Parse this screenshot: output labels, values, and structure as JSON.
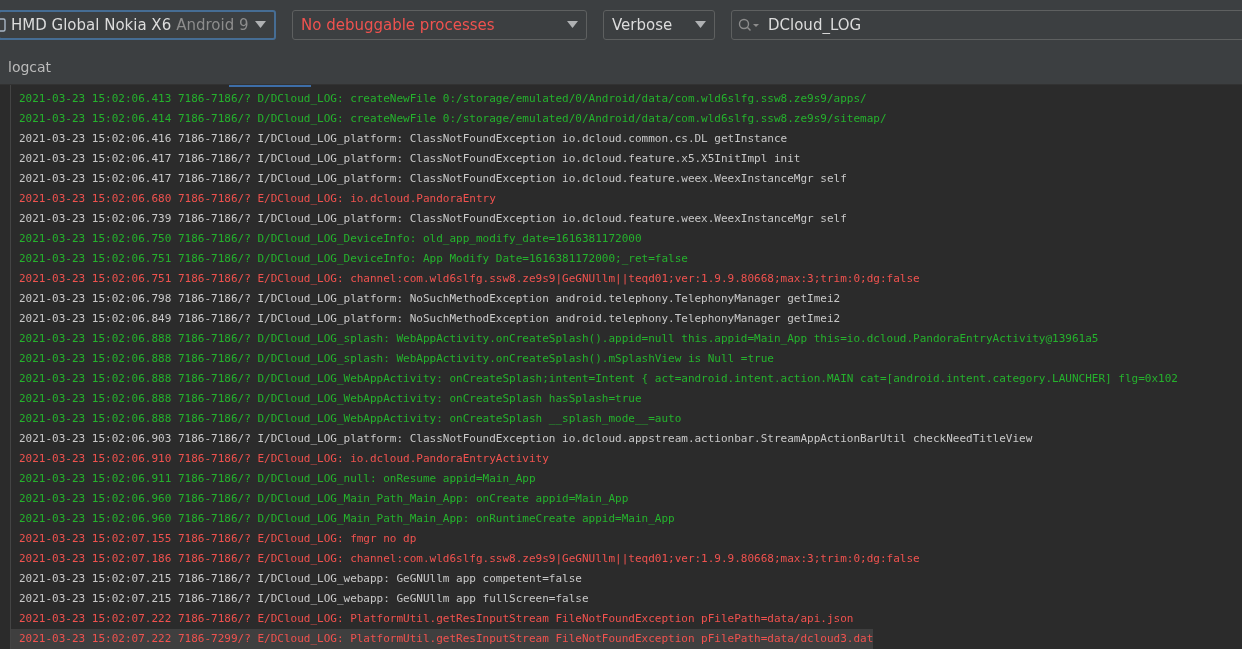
{
  "toolbar": {
    "device": {
      "name": "HMD Global Nokia X6",
      "version": "Android 9",
      "focused": true
    },
    "process": {
      "value": "No debuggable processes",
      "error": true
    },
    "log_level": {
      "value": "Verbose"
    },
    "search": {
      "value": "DCloud_LOG"
    }
  },
  "panel_title": "logcat",
  "rows": [
    {
      "kind": "debug",
      "selected": false,
      "text": "2021-03-23 15:02:06.413 7186-7186/? D/DCloud_LOG: createNewFile 0:/storage/emulated/0/Android/data/com.wld6slfg.ssw8.ze9s9/apps/"
    },
    {
      "kind": "debug",
      "selected": false,
      "text": "2021-03-23 15:02:06.414 7186-7186/? D/DCloud_LOG: createNewFile 0:/storage/emulated/0/Android/data/com.wld6slfg.ssw8.ze9s9/sitemap/"
    },
    {
      "kind": "info",
      "selected": false,
      "text": "2021-03-23 15:02:06.416 7186-7186/? I/DCloud_LOG_platform: ClassNotFoundException io.dcloud.common.cs.DL getInstance"
    },
    {
      "kind": "info",
      "selected": false,
      "text": "2021-03-23 15:02:06.417 7186-7186/? I/DCloud_LOG_platform: ClassNotFoundException io.dcloud.feature.x5.X5InitImpl init"
    },
    {
      "kind": "info",
      "selected": false,
      "text": "2021-03-23 15:02:06.417 7186-7186/? I/DCloud_LOG_platform: ClassNotFoundException io.dcloud.feature.weex.WeexInstanceMgr self"
    },
    {
      "kind": "error",
      "selected": false,
      "text": "2021-03-23 15:02:06.680 7186-7186/? E/DCloud_LOG: io.dcloud.PandoraEntry"
    },
    {
      "kind": "info",
      "selected": false,
      "text": "2021-03-23 15:02:06.739 7186-7186/? I/DCloud_LOG_platform: ClassNotFoundException io.dcloud.feature.weex.WeexInstanceMgr self"
    },
    {
      "kind": "debug",
      "selected": false,
      "text": "2021-03-23 15:02:06.750 7186-7186/? D/DCloud_LOG_DeviceInfo: old_app_modify_date=1616381172000"
    },
    {
      "kind": "debug",
      "selected": false,
      "text": "2021-03-23 15:02:06.751 7186-7186/? D/DCloud_LOG_DeviceInfo: App Modify Date=1616381172000;_ret=false"
    },
    {
      "kind": "error",
      "selected": false,
      "text": "2021-03-23 15:02:06.751 7186-7186/? E/DCloud_LOG: channel:com.wld6slfg.ssw8.ze9s9|GeGNUllm||teqd01;ver:1.9.9.80668;max:3;trim:0;dg:false"
    },
    {
      "kind": "info",
      "selected": false,
      "text": "2021-03-23 15:02:06.798 7186-7186/? I/DCloud_LOG_platform: NoSuchMethodException android.telephony.TelephonyManager getImei2"
    },
    {
      "kind": "info",
      "selected": false,
      "text": "2021-03-23 15:02:06.849 7186-7186/? I/DCloud_LOG_platform: NoSuchMethodException android.telephony.TelephonyManager getImei2"
    },
    {
      "kind": "debug",
      "selected": false,
      "text": "2021-03-23 15:02:06.888 7186-7186/? D/DCloud_LOG_splash: WebAppActivity.onCreateSplash().appid=null this.appid=Main_App this=io.dcloud.PandoraEntryActivity@13961a5"
    },
    {
      "kind": "debug",
      "selected": false,
      "text": "2021-03-23 15:02:06.888 7186-7186/? D/DCloud_LOG_splash: WebAppActivity.onCreateSplash().mSplashView is Null =true"
    },
    {
      "kind": "debug",
      "selected": false,
      "text": "2021-03-23 15:02:06.888 7186-7186/? D/DCloud_LOG_WebAppActivity: onCreateSplash;intent=Intent { act=android.intent.action.MAIN cat=[android.intent.category.LAUNCHER] flg=0x102"
    },
    {
      "kind": "debug",
      "selected": false,
      "text": "2021-03-23 15:02:06.888 7186-7186/? D/DCloud_LOG_WebAppActivity: onCreateSplash hasSplash=true"
    },
    {
      "kind": "debug",
      "selected": false,
      "text": "2021-03-23 15:02:06.888 7186-7186/? D/DCloud_LOG_WebAppActivity: onCreateSplash __splash_mode__=auto"
    },
    {
      "kind": "info",
      "selected": false,
      "text": "2021-03-23 15:02:06.903 7186-7186/? I/DCloud_LOG_platform: ClassNotFoundException io.dcloud.appstream.actionbar.StreamAppActionBarUtil checkNeedTitleView"
    },
    {
      "kind": "error",
      "selected": false,
      "text": "2021-03-23 15:02:06.910 7186-7186/? E/DCloud_LOG: io.dcloud.PandoraEntryActivity"
    },
    {
      "kind": "debug",
      "selected": false,
      "text": "2021-03-23 15:02:06.911 7186-7186/? D/DCloud_LOG_null: onResume appid=Main_App"
    },
    {
      "kind": "debug",
      "selected": false,
      "text": "2021-03-23 15:02:06.960 7186-7186/? D/DCloud_LOG_Main_Path_Main_App: onCreate appid=Main_App"
    },
    {
      "kind": "debug",
      "selected": false,
      "text": "2021-03-23 15:02:06.960 7186-7186/? D/DCloud_LOG_Main_Path_Main_App: onRuntimeCreate appid=Main_App"
    },
    {
      "kind": "error",
      "selected": false,
      "text": "2021-03-23 15:02:07.155 7186-7186/? E/DCloud_LOG: fmgr no dp"
    },
    {
      "kind": "error",
      "selected": false,
      "text": "2021-03-23 15:02:07.186 7186-7186/? E/DCloud_LOG: channel:com.wld6slfg.ssw8.ze9s9|GeGNUllm||teqd01;ver:1.9.9.80668;max:3;trim:0;dg:false"
    },
    {
      "kind": "info",
      "selected": false,
      "text": "2021-03-23 15:02:07.215 7186-7186/? I/DCloud_LOG_webapp: GeGNUllm app competent=false"
    },
    {
      "kind": "info",
      "selected": false,
      "text": "2021-03-23 15:02:07.215 7186-7186/? I/DCloud_LOG_webapp: GeGNUllm app fullScreen=false"
    },
    {
      "kind": "error",
      "selected": false,
      "text": "2021-03-23 15:02:07.222 7186-7186/? E/DCloud_LOG: PlatformUtil.getResInputStream FileNotFoundException pFilePath=data/api.json"
    },
    {
      "kind": "error",
      "selected": true,
      "text": "2021-03-23 15:02:07.222 7186-7299/? E/DCloud_LOG: PlatformUtil.getResInputStream FileNotFoundException pFilePath=data/dcloud3.dat"
    }
  ]
}
